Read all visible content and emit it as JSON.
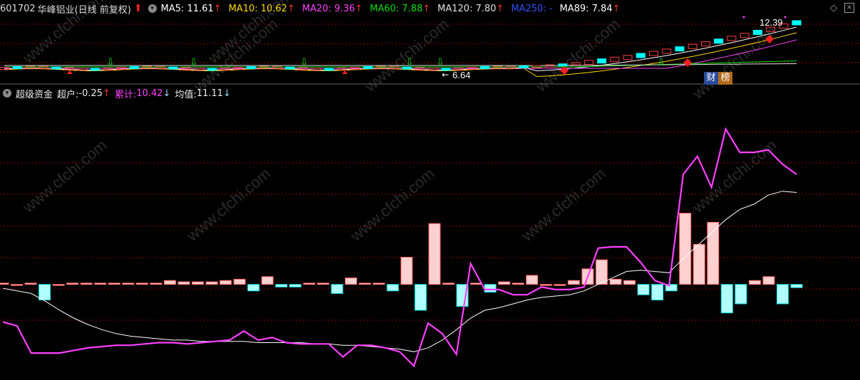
{
  "header": {
    "stock_code": "601702",
    "stock_name": "华峰铝业",
    "period": "(日线 前复权)",
    "ma": [
      {
        "label": "MA5:",
        "value": "11.61",
        "arrow": "↑",
        "color": "#ffffff"
      },
      {
        "label": "MA10:",
        "value": "10.62",
        "arrow": "↑",
        "color": "#ffd800"
      },
      {
        "label": "MA20:",
        "value": "9.36",
        "arrow": "↑",
        "color": "#ff40ff"
      },
      {
        "label": "MA60:",
        "value": "7.88",
        "arrow": "↑",
        "color": "#00e000"
      },
      {
        "label": "MA120:",
        "value": "7.80",
        "arrow": "↑",
        "color": "#e0e0e0"
      },
      {
        "label": "MA250:",
        "value": "-",
        "arrow": "",
        "color": "#3050ff"
      },
      {
        "label": "MA89:",
        "value": "7.84",
        "arrow": "↑",
        "color": "#ffffff"
      }
    ]
  },
  "price_chart": {
    "high_label": "12.39",
    "low_label": "6.64",
    "tag_cai": "财",
    "tag_bang": "榜"
  },
  "indicator": {
    "name": "超级资金",
    "chaohu_label": "超户:",
    "chaohu_value": "-0.25",
    "chaohu_arrow": "↑",
    "leiji_label": "累计:",
    "leiji_value": "10.42",
    "leiji_arrow": "↓",
    "junzhi_label": "均值:",
    "junzhi_value": "11.11",
    "junzhi_arrow": "↓"
  },
  "watermark": "www.cfchi.com",
  "colors": {
    "up": "#ff3030",
    "down": "#00ffff",
    "leiji": "#ff40ff",
    "junzhi": "#ffffff",
    "grid": "#8b0000"
  },
  "chart_data": {
    "type": "line",
    "series": [
      {
        "name": "累计",
        "values": [
          -2.9,
          -3.2,
          -5.3,
          -5.3,
          -5.3,
          -5.1,
          -4.9,
          -4.8,
          -4.7,
          -4.7,
          -4.6,
          -4.5,
          -4.5,
          -4.6,
          -4.5,
          -4.4,
          -4.3,
          -3.6,
          -4.3,
          -4.1,
          -4.5,
          -4.6,
          -4.6,
          -4.6,
          -5.6,
          -4.7,
          -4.7,
          -4.9,
          -5.2,
          -6.3,
          -3.0,
          -3.8,
          -5.4,
          1.6,
          -0.4,
          -0.4,
          -0.8,
          -0.8,
          -0.2,
          -0.4,
          -0.4,
          -0.2,
          2.8,
          2.9,
          2.9,
          1.7,
          0.3,
          -0.1,
          8.5,
          9.9,
          7.5,
          12.0,
          10.2,
          10.2,
          10.4,
          9.3,
          8.5
        ]
      },
      {
        "name": "均值",
        "values": [
          -0.3,
          -0.5,
          -0.7,
          -1.3,
          -2.0,
          -2.6,
          -3.1,
          -3.5,
          -3.8,
          -4.0,
          -4.1,
          -4.2,
          -4.3,
          -4.3,
          -4.4,
          -4.4,
          -4.4,
          -4.4,
          -4.5,
          -4.5,
          -4.5,
          -4.5,
          -4.6,
          -4.6,
          -4.7,
          -4.7,
          -4.8,
          -4.9,
          -5.0,
          -5.2,
          -4.9,
          -4.3,
          -3.5,
          -2.6,
          -2.0,
          -1.8,
          -1.5,
          -1.2,
          -1.0,
          -0.9,
          -0.8,
          -0.5,
          0.0,
          0.5,
          1.0,
          1.1,
          1.0,
          0.9,
          2.0,
          3.0,
          4.0,
          5.0,
          5.8,
          6.2,
          6.9,
          7.2,
          7.1
        ]
      },
      {
        "name": "超户",
        "values": [
          0.1,
          0.0,
          0.1,
          -1.2,
          0.0,
          0.1,
          0.1,
          0.1,
          0.1,
          0.1,
          0.1,
          0.1,
          0.3,
          0.2,
          0.2,
          0.2,
          0.3,
          0.4,
          -0.5,
          0.6,
          -0.2,
          -0.2,
          0.1,
          0.1,
          -0.7,
          0.5,
          0.1,
          0.1,
          -0.5,
          2.1,
          -2.0,
          4.7,
          0.1,
          -1.7,
          0.1,
          -0.6,
          0.2,
          0.1,
          0.7,
          0.0,
          0.0,
          0.3,
          1.2,
          1.9,
          0.4,
          0.3,
          -0.8,
          -1.2,
          -0.5,
          5.5,
          3.1,
          4.8,
          -2.2,
          -1.5,
          0.3,
          0.6,
          -1.5,
          -0.25
        ]
      }
    ],
    "ylim": [
      -7,
      14
    ]
  }
}
